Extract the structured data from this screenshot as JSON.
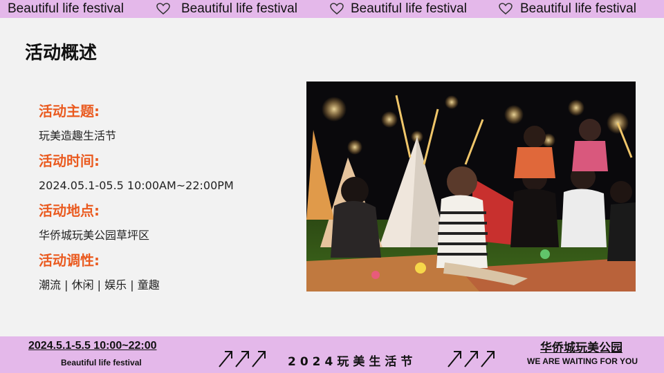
{
  "top_banner": {
    "text": "Beautiful life festival",
    "icon": "heart-outline-icon",
    "color": "#e4b8ea"
  },
  "overview": {
    "title": "活动概述",
    "items": [
      {
        "label": "活动主题:",
        "value": "玩美造趣生活节"
      },
      {
        "label": "活动时间:",
        "value": "2024.05.1-05.5 10:00AM~22:00PM"
      },
      {
        "label": "活动地点:",
        "value": "华侨城玩美公园草坪区"
      },
      {
        "label": "活动调性:",
        "value": "潮流 | 休闲 | 娱乐 | 童趣"
      }
    ],
    "label_color": "#ea5a1f"
  },
  "photo": {
    "description_icon": "night-festival-photo"
  },
  "bottom_banner": {
    "date": "2024.5.1-5.5 10:00~22:00",
    "subtitle": "Beautiful life festival",
    "center_title": "2024玩美生活节",
    "right_title": "华侨城玩美公园",
    "right_subtitle": "WE ARE WAITING FOR YOU",
    "arrow_icon": "diagonal-arrows-icon"
  }
}
